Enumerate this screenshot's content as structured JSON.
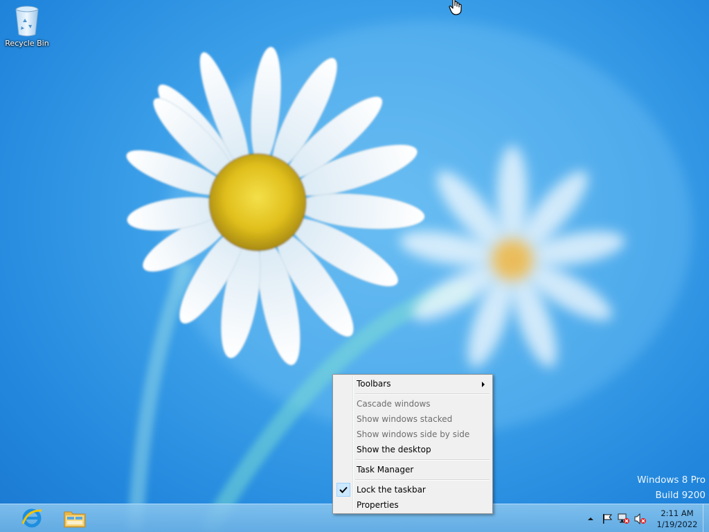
{
  "desktop": {
    "icons": [
      {
        "label": "Recycle Bin",
        "icon": "recycle-bin-icon"
      }
    ]
  },
  "watermark": {
    "line1": "Windows 8 Pro",
    "line2": "Build 9200"
  },
  "context_menu": {
    "items": [
      {
        "label": "Toolbars",
        "enabled": true,
        "submenu": true
      },
      {
        "label": "Cascade windows",
        "enabled": false
      },
      {
        "label": "Show windows stacked",
        "enabled": false
      },
      {
        "label": "Show windows side by side",
        "enabled": false
      },
      {
        "label": "Show the desktop",
        "enabled": true
      },
      {
        "label": "Task Manager",
        "enabled": true
      },
      {
        "label": "Lock the taskbar",
        "enabled": true,
        "checked": true
      },
      {
        "label": "Properties",
        "enabled": true
      }
    ]
  },
  "taskbar": {
    "pinned": [
      {
        "name": "Internet Explorer",
        "icon": "internet-explorer-icon"
      },
      {
        "name": "File Explorer",
        "icon": "file-explorer-icon"
      }
    ],
    "tray": {
      "icons": [
        "show-hidden-icons-chevron",
        "action-center-flag-icon",
        "network-disconnected-icon",
        "volume-muted-icon"
      ],
      "time": "2:11 AM",
      "date": "1/19/2022"
    }
  },
  "colors": {
    "wallpaper": "#2a90e0",
    "taskbar": "#7fc0ec",
    "menu_background": "#f0f0f0",
    "disabled_text": "#6d6d6d"
  }
}
